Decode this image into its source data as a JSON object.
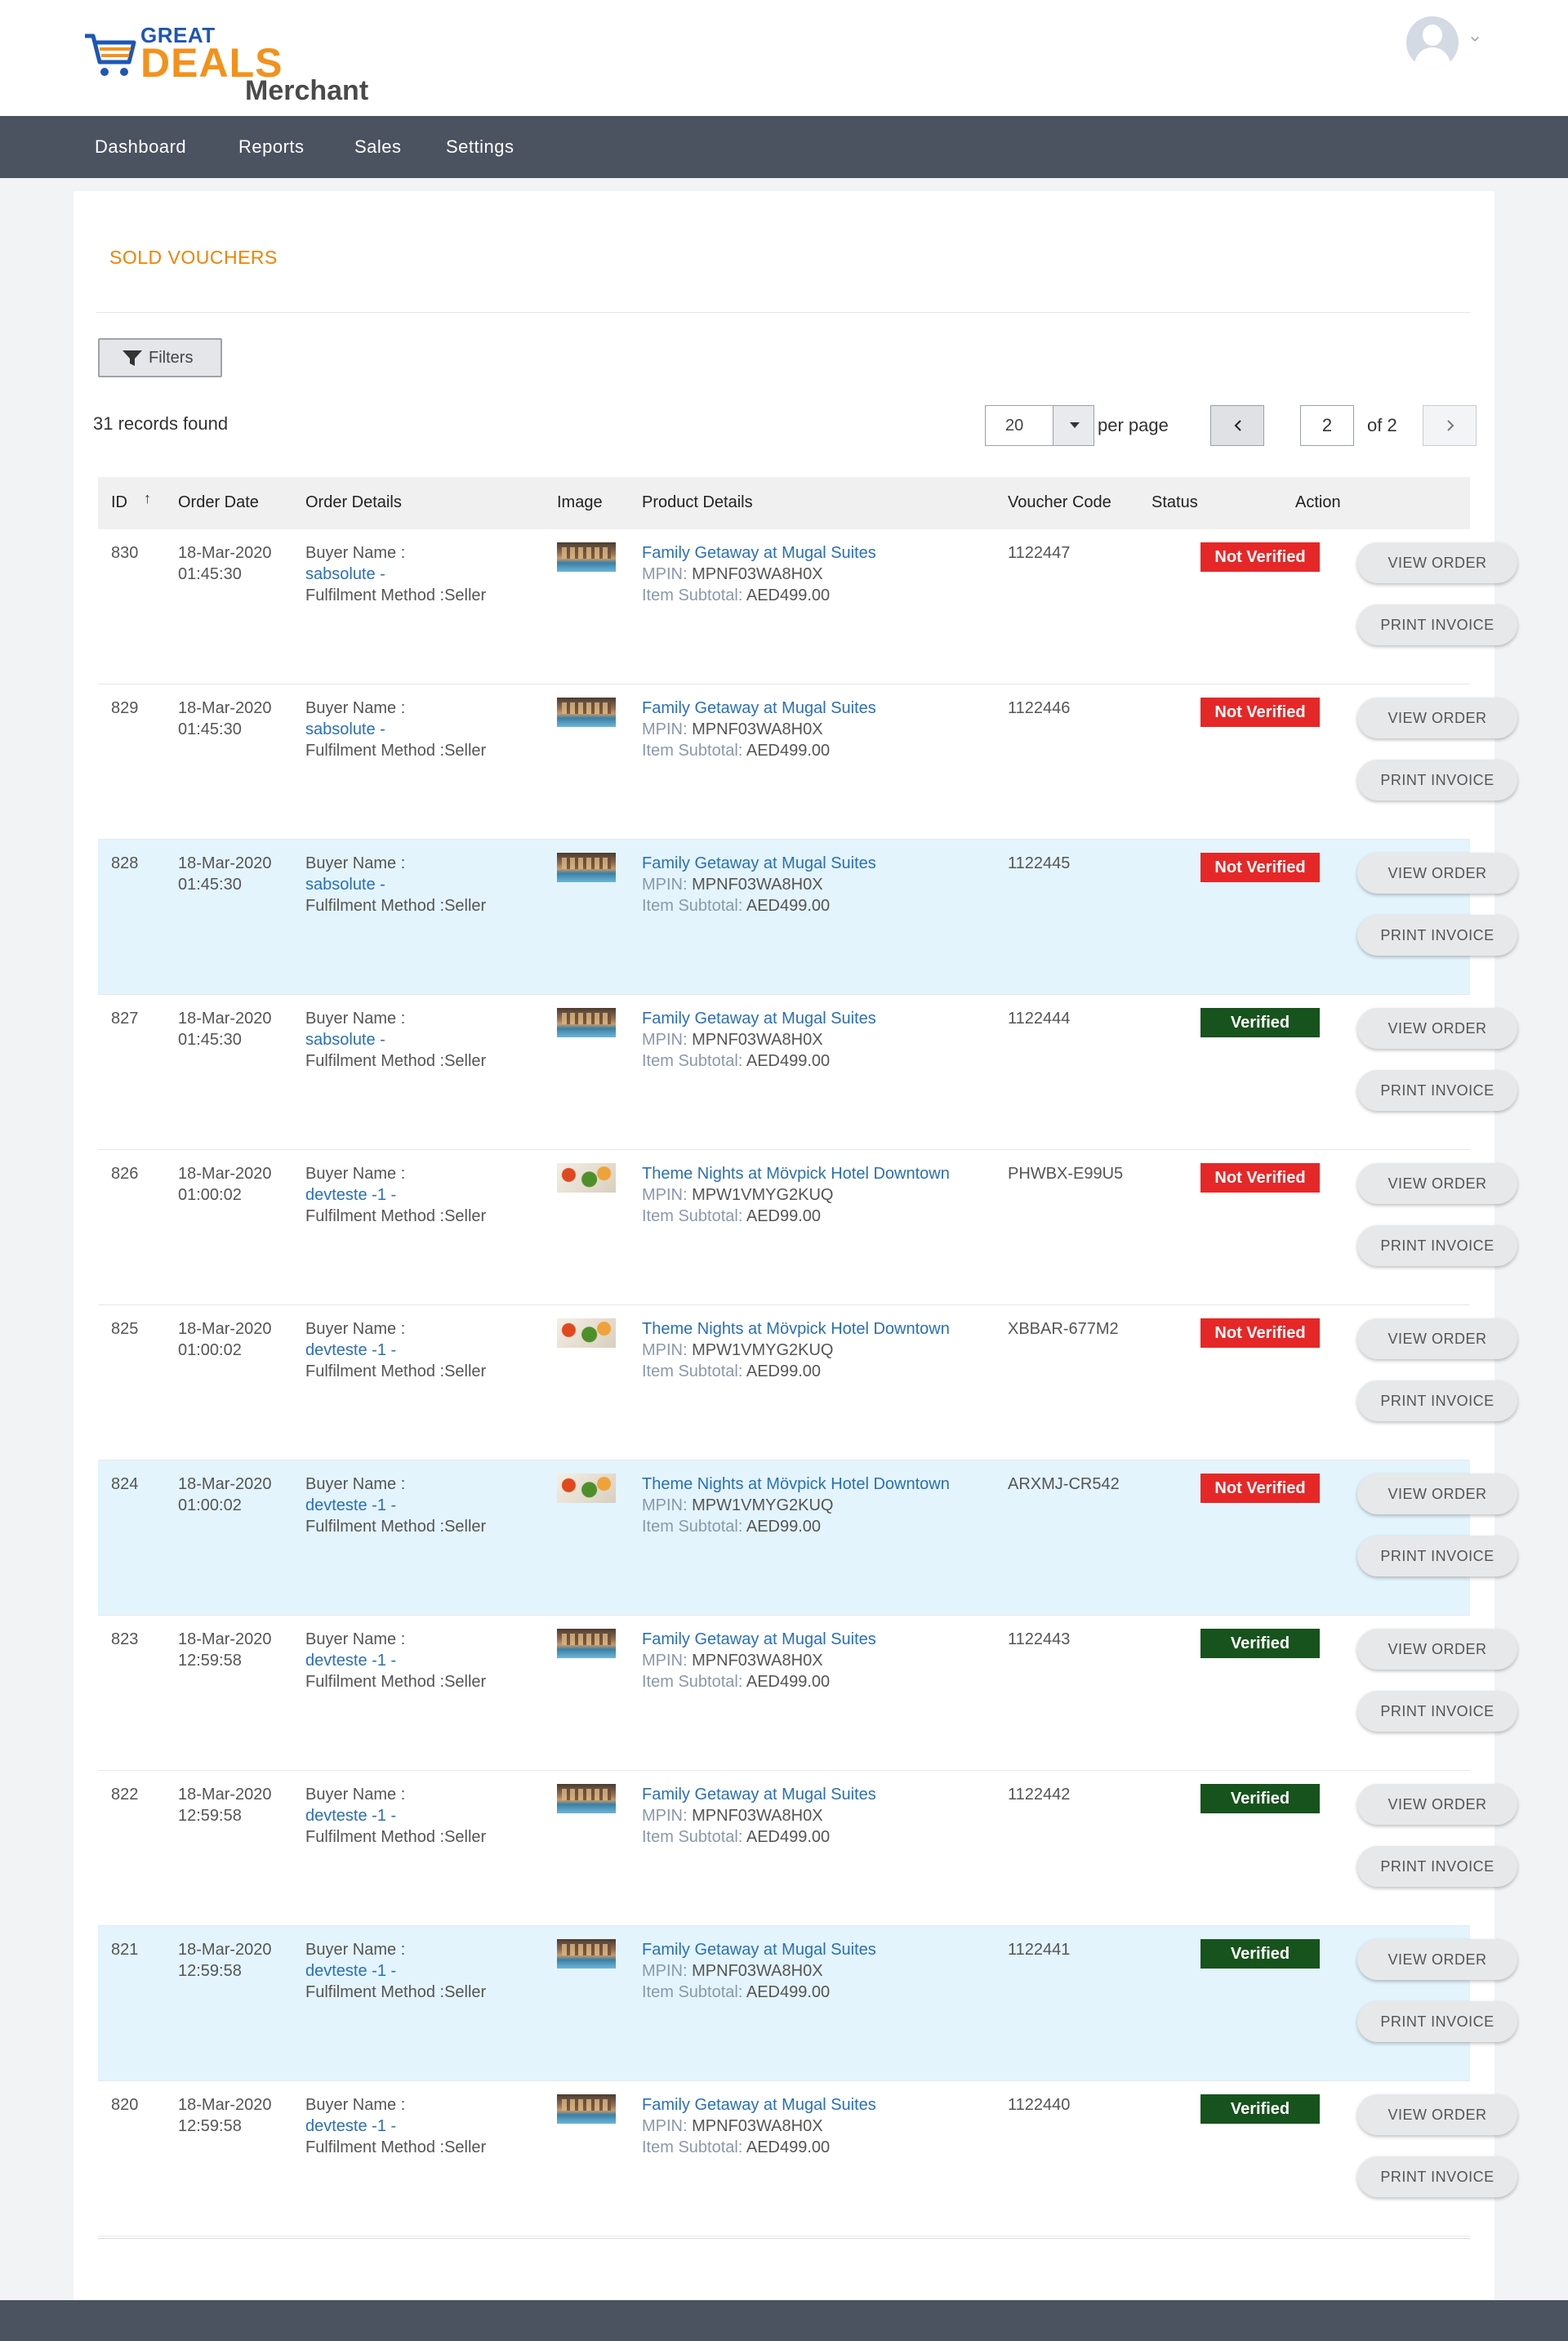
{
  "header": {
    "logo_great": "GREAT",
    "logo_deals": "DEALS",
    "logo_merchant": "Merchant"
  },
  "nav": {
    "items": [
      "Dashboard",
      "Reports",
      "Sales",
      "Settings"
    ]
  },
  "page": {
    "title": "SOLD VOUCHERS",
    "filters_label": "Filters",
    "records_found": "31 records found",
    "per_page_value": "20",
    "per_page_label": "per page",
    "current_page": "2",
    "page_total": "of 2"
  },
  "table": {
    "headers": {
      "id": "ID",
      "order_date": "Order Date",
      "order_details": "Order Details",
      "image": "Image",
      "product_details": "Product Details",
      "voucher_code": "Voucher Code",
      "status": "Status",
      "action": "Action"
    },
    "labels": {
      "buyer_name": "Buyer Name :",
      "fulfilment": "Fulfilment Method :Seller",
      "mpin": "MPIN:",
      "item_subtotal": "Item Subtotal:",
      "view_order": "VIEW ORDER",
      "print_invoice": "PRINT INVOICE"
    },
    "rows": [
      {
        "id": "830",
        "date": "18-Mar-2020",
        "time": "01:45:30",
        "buyer": "sabsolute -",
        "image": "hotel",
        "product": "Family Getaway at Mugal Suites",
        "mpin": "MPNF03WA8H0X",
        "subtotal": "AED499.00",
        "voucher": "1122447",
        "status": "Not Verified",
        "alt": false
      },
      {
        "id": "829",
        "date": "18-Mar-2020",
        "time": "01:45:30",
        "buyer": "sabsolute -",
        "image": "hotel",
        "product": "Family Getaway at Mugal Suites",
        "mpin": "MPNF03WA8H0X",
        "subtotal": "AED499.00",
        "voucher": "1122446",
        "status": "Not Verified",
        "alt": false
      },
      {
        "id": "828",
        "date": "18-Mar-2020",
        "time": "01:45:30",
        "buyer": "sabsolute -",
        "image": "hotel",
        "product": "Family Getaway at Mugal Suites",
        "mpin": "MPNF03WA8H0X",
        "subtotal": "AED499.00",
        "voucher": "1122445",
        "status": "Not Verified",
        "alt": true
      },
      {
        "id": "827",
        "date": "18-Mar-2020",
        "time": "01:45:30",
        "buyer": "sabsolute -",
        "image": "hotel",
        "product": "Family Getaway at Mugal Suites",
        "mpin": "MPNF03WA8H0X",
        "subtotal": "AED499.00",
        "voucher": "1122444",
        "status": "Verified",
        "alt": false
      },
      {
        "id": "826",
        "date": "18-Mar-2020",
        "time": "01:00:02",
        "buyer": "devteste -1 -",
        "image": "food",
        "product": "Theme Nights at Mövpick Hotel Downtown",
        "mpin": "MPW1VMYG2KUQ",
        "subtotal": "AED99.00",
        "voucher": "PHWBX-E99U5",
        "status": "Not Verified",
        "alt": false
      },
      {
        "id": "825",
        "date": "18-Mar-2020",
        "time": "01:00:02",
        "buyer": "devteste -1 -",
        "image": "food",
        "product": "Theme Nights at Mövpick Hotel Downtown",
        "mpin": "MPW1VMYG2KUQ",
        "subtotal": "AED99.00",
        "voucher": "XBBAR-677M2",
        "status": "Not Verified",
        "alt": false
      },
      {
        "id": "824",
        "date": "18-Mar-2020",
        "time": "01:00:02",
        "buyer": "devteste -1 -",
        "image": "food",
        "product": "Theme Nights at Mövpick Hotel Downtown",
        "mpin": "MPW1VMYG2KUQ",
        "subtotal": "AED99.00",
        "voucher": "ARXMJ-CR542",
        "status": "Not Verified",
        "alt": true
      },
      {
        "id": "823",
        "date": "18-Mar-2020",
        "time": "12:59:58",
        "buyer": "devteste -1 -",
        "image": "hotel",
        "product": "Family Getaway at Mugal Suites",
        "mpin": "MPNF03WA8H0X",
        "subtotal": "AED499.00",
        "voucher": "1122443",
        "status": "Verified",
        "alt": false
      },
      {
        "id": "822",
        "date": "18-Mar-2020",
        "time": "12:59:58",
        "buyer": "devteste -1 -",
        "image": "hotel",
        "product": "Family Getaway at Mugal Suites",
        "mpin": "MPNF03WA8H0X",
        "subtotal": "AED499.00",
        "voucher": "1122442",
        "status": "Verified",
        "alt": false
      },
      {
        "id": "821",
        "date": "18-Mar-2020",
        "time": "12:59:58",
        "buyer": "devteste -1 -",
        "image": "hotel",
        "product": "Family Getaway at Mugal Suites",
        "mpin": "MPNF03WA8H0X",
        "subtotal": "AED499.00",
        "voucher": "1122441",
        "status": "Verified",
        "alt": true
      },
      {
        "id": "820",
        "date": "18-Mar-2020",
        "time": "12:59:58",
        "buyer": "devteste -1 -",
        "image": "hotel",
        "product": "Family Getaway at Mugal Suites",
        "mpin": "MPNF03WA8H0X",
        "subtotal": "AED499.00",
        "voucher": "1122440",
        "status": "Verified",
        "alt": false
      }
    ]
  },
  "colors": {
    "brand_orange": "#f08300",
    "brand_blue": "#1e56b4",
    "nav_bg": "#4b5260",
    "not_verified": "#e62727",
    "verified": "#17531c",
    "link": "#2a6fb8",
    "row_highlight": "#e3f4fc"
  },
  "icons": {
    "filter": "funnel-icon",
    "sort": "sort-up-arrow-icon",
    "prev": "chevron-left-icon",
    "next": "chevron-right-icon",
    "dropdown": "caret-down-icon",
    "avatar": "user-avatar-icon"
  }
}
